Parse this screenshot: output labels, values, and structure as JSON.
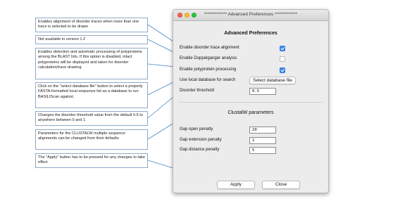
{
  "callouts": [
    "Enables alignment of disorder traces when more than one trace is selected to be drawn",
    "Not available in version 1.2",
    "Enables detection and automatic processing of polyproteins among the BLAST hits. If this option is disabled, intact polyproteins will be displayed and taken for disorder calculation/trace drawing",
    "Click on the \"select database file\" button to select a properly FASTA-formatted local sequence list as a database to run BASILIScan against.",
    "Changes the disorder threshold value from the default 0.5 to anywhere between 0 and 1",
    "Parameters for the CLUSTALW multiple sequence alignments can be changed from their defaults",
    "The \"Apply\" button has to be pressed for any changes to take effect"
  ],
  "window": {
    "title": "************* Advanced Preferences *************"
  },
  "advanced": {
    "heading": "Advanced Preferences",
    "disorder_trace_label": "Enable disorder trace alignment",
    "disorder_trace_checked": true,
    "doppelganger_label": "Enable Doppelganger analysis",
    "doppelganger_checked": false,
    "polyprotein_label": "Enable polyprotein processing",
    "polyprotein_checked": true,
    "local_db_label": "Use local database for search",
    "select_db_button": "Select database file",
    "threshold_label": "Disorder threshold",
    "threshold_value": "0.5"
  },
  "clustalw": {
    "heading": "ClustalW parameters",
    "gap_open_label": "Gap open penalty",
    "gap_open_value": "20",
    "gap_extension_label": "Gap extension penalty",
    "gap_extension_value": "1",
    "gap_distance_label": "Gap distance penalty",
    "gap_distance_value": "5"
  },
  "buttons": {
    "apply": "Apply",
    "close": "Close"
  },
  "colors": {
    "checkbox_accent": "#3f8bf2",
    "callout_border": "#8fa9c9",
    "leader_line": "#4a86c6"
  }
}
